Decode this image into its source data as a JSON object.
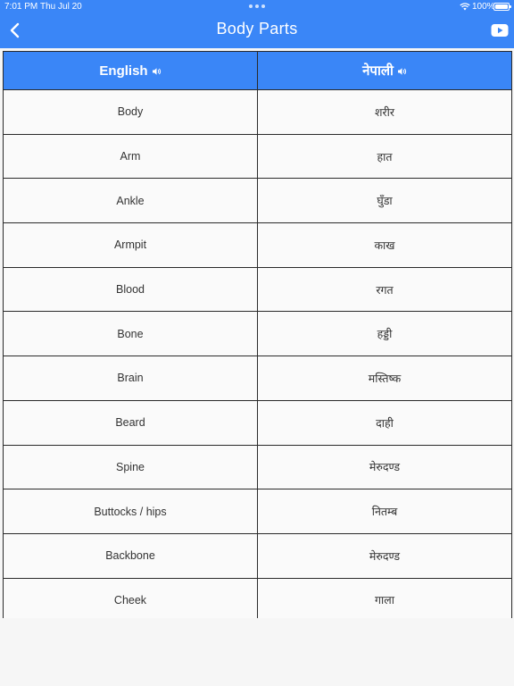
{
  "status_bar": {
    "time": "7:01 PM",
    "date": "Thu Jul 20",
    "battery": "100%"
  },
  "nav": {
    "title": "Body Parts",
    "back_icon": "chevron-left-icon",
    "video_icon": "youtube-play-icon"
  },
  "colors": {
    "accent": "#3a86f7",
    "header_text": "#ffffff",
    "grid": "#2a2a2a"
  },
  "table": {
    "headers": [
      {
        "label": "English",
        "icon": "speaker-icon"
      },
      {
        "label": "नेपाली",
        "icon": "speaker-icon"
      }
    ],
    "rows": [
      {
        "english": "Body",
        "nepali": "शरीर"
      },
      {
        "english": "Arm",
        "nepali": "हात"
      },
      {
        "english": "Ankle",
        "nepali": "घुँडा"
      },
      {
        "english": "Armpit",
        "nepali": "काख"
      },
      {
        "english": "Blood",
        "nepali": "रगत"
      },
      {
        "english": "Bone",
        "nepali": "हड्डी"
      },
      {
        "english": "Brain",
        "nepali": "मस्तिष्क"
      },
      {
        "english": "Beard",
        "nepali": "दाही"
      },
      {
        "english": "Spine",
        "nepali": "मेरुदण्ड"
      },
      {
        "english": "Buttocks / hips",
        "nepali": "नितम्ब"
      },
      {
        "english": "Backbone",
        "nepali": "मेरुदण्ड"
      },
      {
        "english": "Cheek",
        "nepali": "गाला"
      }
    ]
  }
}
